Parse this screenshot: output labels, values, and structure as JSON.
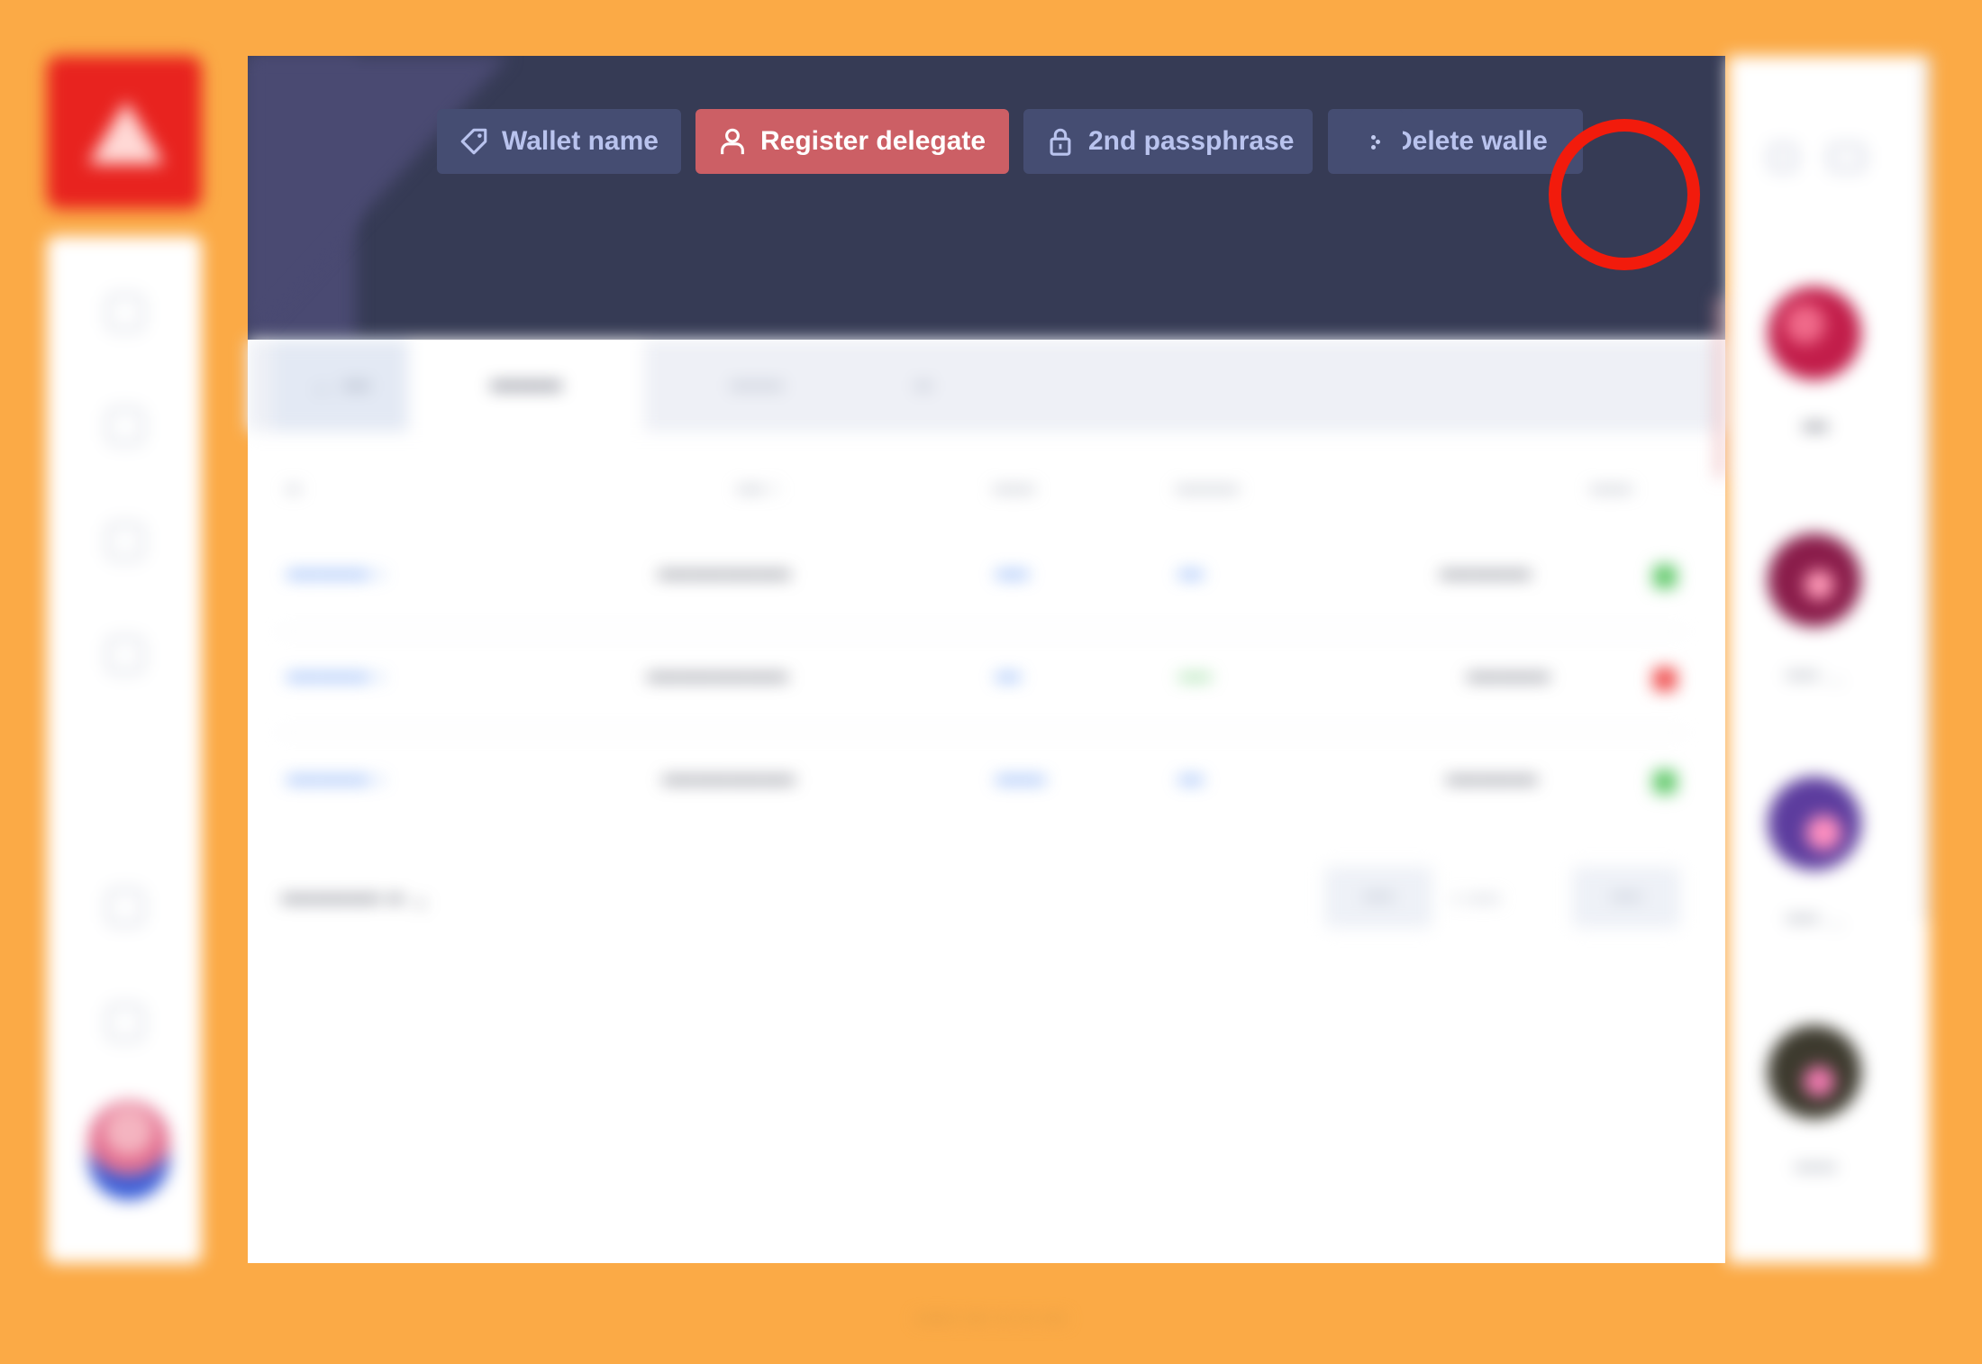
{
  "header": {
    "buttons": [
      {
        "label": "Wallet name",
        "icon": "tag-icon"
      },
      {
        "label": "Register delegate",
        "icon": "user-icon"
      },
      {
        "label": "2nd passphrase",
        "icon": "lock-icon"
      },
      {
        "label": "Delete walle",
        "icon": "eraser-icon"
      }
    ],
    "more_icon": "more-dots-icon"
  },
  "colors": {
    "background": "#fbaa46",
    "brand_red": "#e8231f",
    "header": "#363b55",
    "button": "#454d72",
    "accent_button": "#cc5f65",
    "highlight": "#f21b0c",
    "link": "#3d7ff3"
  }
}
